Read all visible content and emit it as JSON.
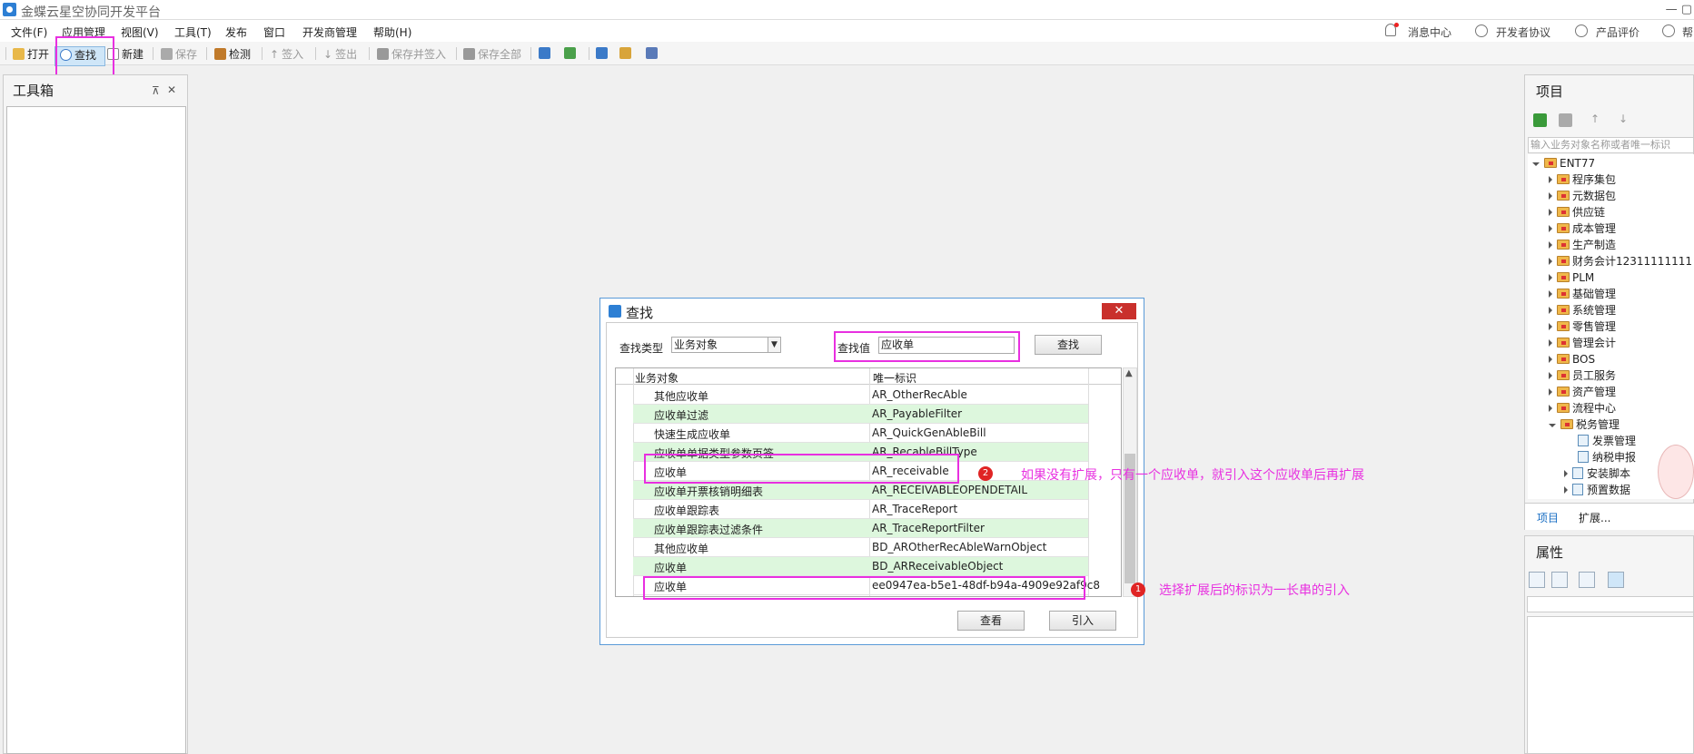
{
  "app": {
    "title": "金蝶云星空协同开发平台"
  },
  "menu": {
    "items": [
      "文件(F)",
      "应用管理",
      "视图(V)",
      "工具(T)",
      "发布",
      "窗口",
      "开发商管理",
      "帮助(H)"
    ],
    "right": [
      "消息中心",
      "开发者协议",
      "产品评价",
      "帮"
    ]
  },
  "toolbar": {
    "open": "打开",
    "find": "查找",
    "new": "新建",
    "save": "保存",
    "check": "检测",
    "checkin": "签入",
    "checkout": "签出",
    "save_checkin": "保存并签入",
    "save_all": "保存全部"
  },
  "toolbox": {
    "title": "工具箱",
    "pin": "⊼",
    "close": "✕"
  },
  "project": {
    "title": "项目",
    "search_placeholder": "输入业务对象名称或者唯一标识",
    "root": "ENT77",
    "nodes": [
      "程序集包",
      "元数据包",
      "供应链",
      "成本管理",
      "生产制造",
      "财务会计12311111111",
      "PLM",
      "基础管理",
      "系统管理",
      "零售管理",
      "管理会计",
      "BOS",
      "员工服务",
      "资产管理",
      "流程中心",
      "税务管理"
    ],
    "children": [
      "发票管理",
      "纳税申报",
      "安装脚本",
      "预置数据"
    ],
    "tabs": [
      "项目",
      "扩展..."
    ]
  },
  "properties": {
    "title": "属性"
  },
  "dialog": {
    "title": "查找",
    "close": "✕",
    "find_type_label": "查找类型",
    "find_type_value": "业务对象",
    "find_value_label": "查找值",
    "find_value": "应收单",
    "find_button": "查找",
    "columns": [
      "业务对象",
      "唯一标识"
    ],
    "rows": [
      {
        "name": "其他应收单",
        "id": "AR_OtherRecAble"
      },
      {
        "name": "应收单过滤",
        "id": "AR_PayableFilter"
      },
      {
        "name": "快速生成应收单",
        "id": "AR_QuickGenAbleBill"
      },
      {
        "name": "应收单单据类型参数页签",
        "id": "AR_RecableBillType"
      },
      {
        "name": "应收单",
        "id": "AR_receivable"
      },
      {
        "name": "应收单开票核销明细表",
        "id": "AR_RECEIVABLEOPENDETAIL"
      },
      {
        "name": "应收单跟踪表",
        "id": "AR_TraceReport"
      },
      {
        "name": "应收单跟踪表过滤条件",
        "id": "AR_TraceReportFilter"
      },
      {
        "name": "其他应收单",
        "id": "BD_AROtherRecAbleWarnObject"
      },
      {
        "name": "应收单",
        "id": "BD_ARReceivableObject"
      },
      {
        "name": "应收单",
        "id": "ee0947ea-b5e1-48df-b94a-4909e92af9c8"
      }
    ],
    "view_button": "查看",
    "import_button": "引入"
  },
  "annotations": {
    "badge2": "2",
    "note2": "如果没有扩展，只有一个应收单，就引入这个应收单后再扩展",
    "badge1": "1",
    "note1": "选择扩展后的标识为一长串的引入"
  },
  "colors": {
    "highlight": "#e830e0",
    "row_alt": "#ddf7dd",
    "badge": "#e02424"
  }
}
